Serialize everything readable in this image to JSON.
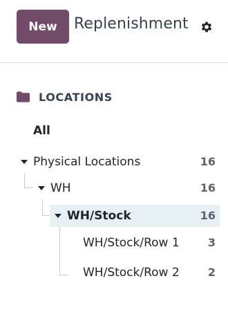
{
  "header": {
    "new_label": "New",
    "title": "Replenishment"
  },
  "sidebar": {
    "section_title": "LOCATIONS",
    "all_label": "All",
    "items": [
      {
        "label": "Physical Locations",
        "count": "16"
      },
      {
        "label": "WH",
        "count": "16"
      },
      {
        "label": "WH/Stock",
        "count": "16",
        "selected": true
      },
      {
        "label": "WH/Stock/Row 1",
        "count": "3"
      },
      {
        "label": "WH/Stock/Row 2",
        "count": "2"
      }
    ]
  },
  "colors": {
    "brand": "#714B67",
    "selected_bg": "#e7f0f3"
  },
  "icons": [
    "folder-icon",
    "gear-icon",
    "caret-down-icon"
  ]
}
